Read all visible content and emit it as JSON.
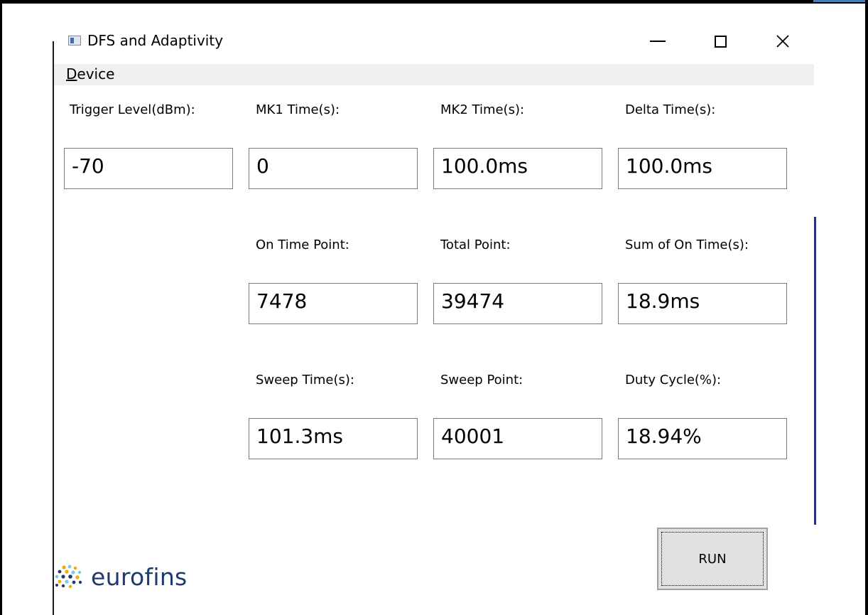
{
  "window": {
    "title": "DFS and Adaptivity",
    "minimize_icon": "minimize-icon",
    "maximize_icon": "maximize-icon",
    "close_icon": "close-icon"
  },
  "menu": {
    "items": [
      {
        "label_accel": "D",
        "label_rest": "evice"
      }
    ]
  },
  "fields": {
    "trigger_level": {
      "label": "Trigger Level(dBm):",
      "value": "-70"
    },
    "mk1_time": {
      "label": "MK1 Time(s):",
      "value": "0"
    },
    "mk2_time": {
      "label": "MK2 Time(s):",
      "value": "100.0ms"
    },
    "delta_time": {
      "label": "Delta Time(s):",
      "value": "100.0ms"
    },
    "on_time_point": {
      "label": "On Time Point:",
      "value": "7478"
    },
    "total_point": {
      "label": "Total Point:",
      "value": "39474"
    },
    "sum_on_time": {
      "label": "Sum of On Time(s):",
      "value": "18.9ms"
    },
    "sweep_time": {
      "label": "Sweep Time(s):",
      "value": "101.3ms"
    },
    "sweep_point": {
      "label": "Sweep Point:",
      "value": "40001"
    },
    "duty_cycle": {
      "label": "Duty Cycle(%):",
      "value": "18.94%"
    }
  },
  "run_button": {
    "label": "RUN"
  },
  "logo": {
    "text": "eurofins",
    "icon": "eurofins-dots-icon"
  },
  "colors": {
    "logo_blue": "#1f3a6e",
    "menu_bg": "#f0f0f0",
    "button_bg": "#e1e1e1",
    "border": "#7a7a7a"
  }
}
